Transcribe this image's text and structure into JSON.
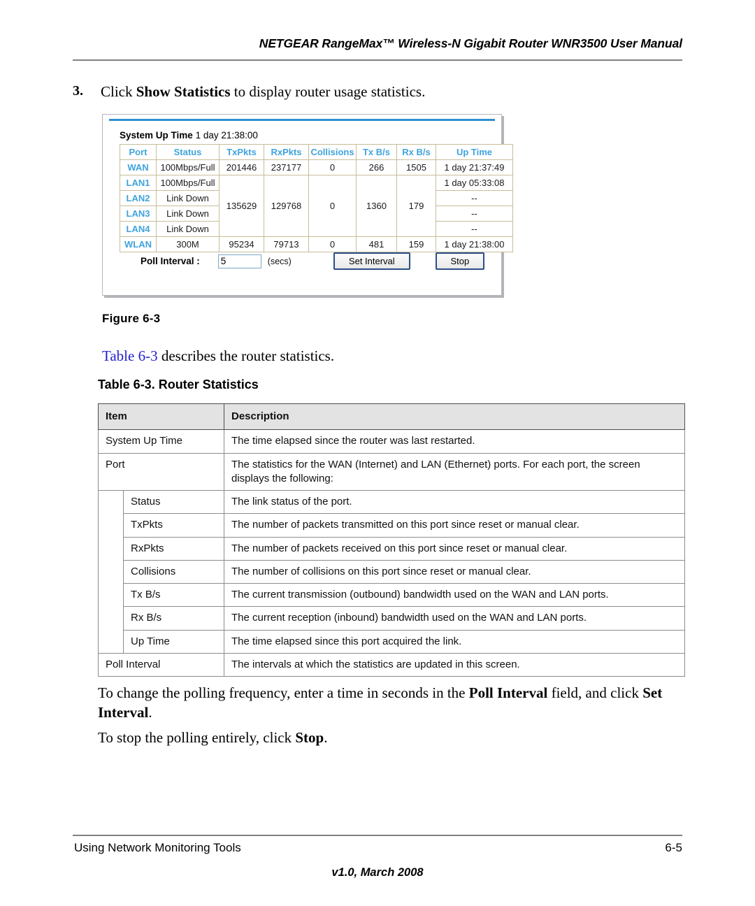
{
  "header": {
    "title": "NETGEAR RangeMax™ Wireless-N Gigabit Router WNR3500 User Manual"
  },
  "step": {
    "number": "3.",
    "text_before": "Click ",
    "bold": "Show Statistics",
    "text_after": " to display router usage statistics."
  },
  "figure": {
    "caption": "Figure 6-3",
    "system_up_time_label": "System Up Time",
    "system_up_time_value": "1 day 21:38:00",
    "stats_table": {
      "columns": [
        "Port",
        "Status",
        "TxPkts",
        "RxPkts",
        "Collisions",
        "Tx B/s",
        "Rx B/s",
        "Up Time"
      ],
      "rows": [
        {
          "port": "WAN",
          "status": "100Mbps/Full",
          "txpkts": "201446",
          "rxpkts": "237177",
          "collisions": "0",
          "txbs": "266",
          "rxbs": "1505",
          "uptime": "1 day 21:37:49"
        },
        {
          "port": "LAN1",
          "status": "100Mbps/Full",
          "uptime": "1 day 05:33:08"
        },
        {
          "port": "LAN2",
          "status": "Link Down",
          "uptime": "--"
        },
        {
          "port": "LAN3",
          "status": "Link Down",
          "uptime": "--"
        },
        {
          "port": "LAN4",
          "status": "Link Down",
          "uptime": "--"
        },
        {
          "port": "WLAN",
          "status": "300M",
          "txpkts": "95234",
          "rxpkts": "79713",
          "collisions": "0",
          "txbs": "481",
          "rxbs": "159",
          "uptime": "1 day 21:38:00"
        }
      ],
      "lan_group": {
        "txpkts": "135629",
        "rxpkts": "129768",
        "collisions": "0",
        "txbs": "1360",
        "rxbs": "179"
      }
    },
    "poll_interval_label": "Poll Interval :",
    "poll_interval_value": "5",
    "poll_interval_units": "(secs)",
    "set_interval_button": "Set Interval",
    "stop_button": "Stop",
    "accent_color": "#2f8fd0",
    "header_text_color": "#3fa3dd",
    "cell_border_color": "#c8bd9a"
  },
  "reference": {
    "link_text": "Table 6-3",
    "rest_text": " describes the router statistics."
  },
  "desc_table": {
    "title": "Table 6-3. Router Statistics",
    "columns": [
      "Item",
      "Description"
    ],
    "rows": [
      {
        "level": "top",
        "item": "System Up Time",
        "description": "The time elapsed since the router was last restarted."
      },
      {
        "level": "top",
        "item": "Port",
        "description": "The statistics for the WAN (Internet) and LAN (Ethernet) ports. For each port, the screen displays the following:"
      },
      {
        "level": "sub",
        "item": "Status",
        "description": "The link status of the port."
      },
      {
        "level": "sub",
        "item": "TxPkts",
        "description": "The number of packets transmitted on this port since reset or manual clear."
      },
      {
        "level": "sub",
        "item": "RxPkts",
        "description": "The number of packets received on this port since reset or manual clear."
      },
      {
        "level": "sub",
        "item": "Collisions",
        "description": "The number of collisions on this port since reset or manual clear."
      },
      {
        "level": "sub",
        "item": "Tx B/s",
        "description": "The current transmission (outbound) bandwidth used on the WAN and LAN ports."
      },
      {
        "level": "sub",
        "item": "Rx B/s",
        "description": "The current reception (inbound) bandwidth used on the WAN and LAN ports."
      },
      {
        "level": "sub",
        "item": "Up Time",
        "description": "The time elapsed since this port acquired the link."
      },
      {
        "level": "top",
        "item": "Poll Interval",
        "description": "The intervals at which the statistics are updated in this screen."
      }
    ]
  },
  "paragraphs": {
    "p1_a": "To change the polling frequency, enter a time in seconds in the ",
    "p1_b": "Poll Interval",
    "p1_c": " field, and click ",
    "p1_d": "Set Interval",
    "p1_e": ".",
    "p2_a": "To stop the polling entirely, click ",
    "p2_b": "Stop",
    "p2_c": "."
  },
  "footer": {
    "left": "Using Network Monitoring Tools",
    "right": "6-5",
    "center": "v1.0, March 2008"
  }
}
